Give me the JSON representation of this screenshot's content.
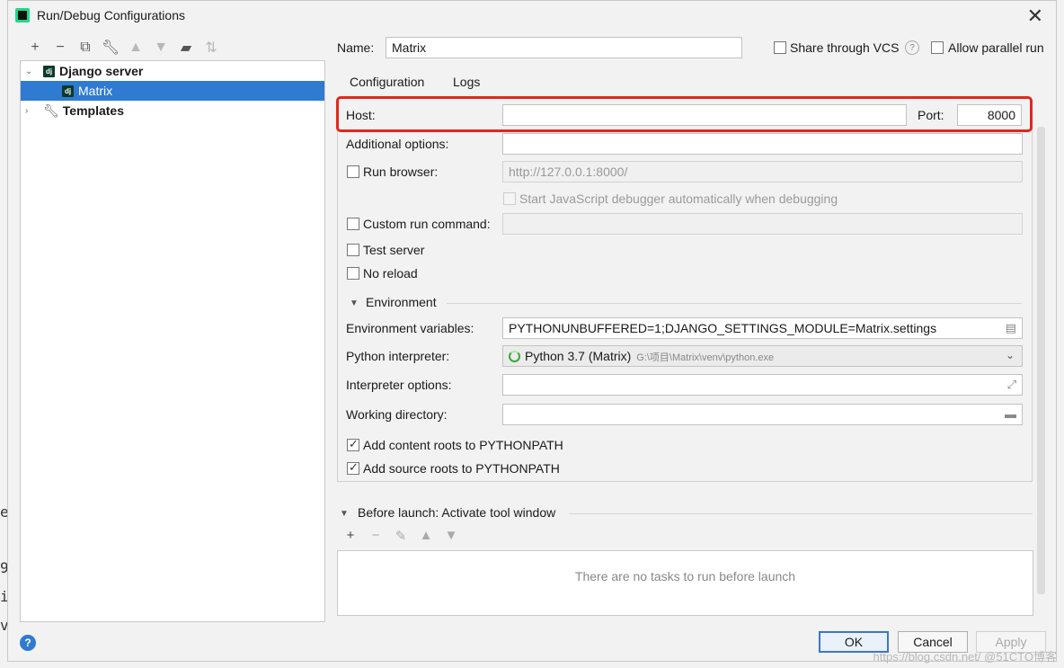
{
  "window": {
    "title": "Run/Debug Configurations"
  },
  "toolbar": {
    "icons": [
      "plus-icon",
      "minus-icon",
      "copy-icon",
      "wrench-icon",
      "arrow-up-icon",
      "arrow-down-icon",
      "folder-add-icon",
      "sort-icon"
    ]
  },
  "tree": {
    "group": "Django server",
    "item": "Matrix",
    "templates": "Templates"
  },
  "header": {
    "name_label": "Name:",
    "name_value": "Matrix",
    "share_vcs_label": "Share through VCS",
    "allow_parallel_label": "Allow parallel run"
  },
  "tabs": [
    "Configuration",
    "Logs"
  ],
  "config": {
    "host_label": "Host:",
    "host_value": "",
    "port_label": "Port:",
    "port_value": "8000",
    "additional_options_label": "Additional options:",
    "run_browser_label": "Run browser:",
    "run_browser_url": "http://127.0.0.1:8000/",
    "js_debugger_label": "Start JavaScript debugger automatically when debugging",
    "custom_run_label": "Custom run command:",
    "test_server_label": "Test server",
    "no_reload_label": "No reload",
    "environment_label": "Environment",
    "env_vars_label": "Environment variables:",
    "env_vars_value": "PYTHONUNBUFFERED=1;DJANGO_SETTINGS_MODULE=Matrix.settings",
    "python_interp_label": "Python interpreter:",
    "python_interp_value": "Python 3.7 (Matrix)",
    "python_interp_path": "G:\\项目\\Matrix\\venv\\python.exe",
    "interp_options_label": "Interpreter options:",
    "working_dir_label": "Working directory:",
    "content_roots_label": "Add content roots to PYTHONPATH",
    "source_roots_label": "Add source roots to PYTHONPATH"
  },
  "before_launch": {
    "label": "Before launch: Activate tool window",
    "empty_text": "There are no tasks to run before launch"
  },
  "buttons": {
    "ok": "OK",
    "cancel": "Cancel",
    "apply": "Apply"
  },
  "help": "?",
  "watermark": "https://blog.csdn.net/ @51CTO博客",
  "bg_fragments": [
    "e",
    "9",
    "i",
    "v"
  ]
}
